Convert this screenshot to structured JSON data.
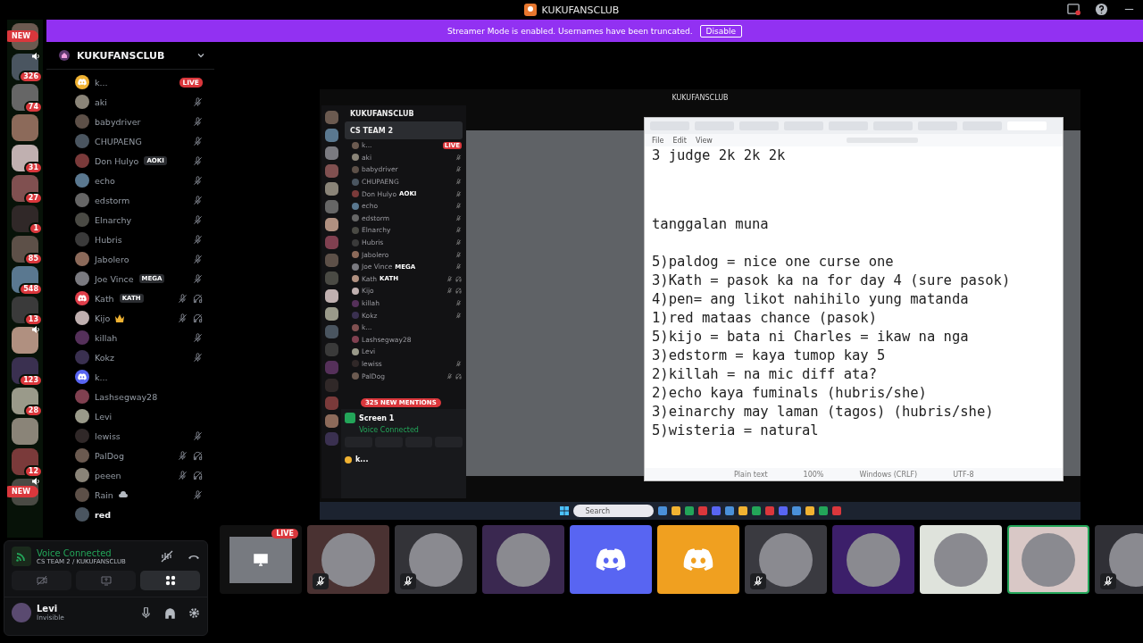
{
  "window": {
    "title": "KUKUFANSCLUB"
  },
  "servers": [
    {
      "badge": "NEW",
      "kind": "pill",
      "speaker": false
    },
    {
      "badge": "326",
      "speaker": true
    },
    {
      "badge": "74",
      "speaker": false
    },
    {
      "speaker": false
    },
    {
      "badge": "31",
      "speaker": false
    },
    {
      "badge": "27",
      "speaker": false
    },
    {
      "badge": "1",
      "speaker": false
    },
    {
      "badge": "85",
      "speaker": false
    },
    {
      "badge": "548",
      "speaker": false
    },
    {
      "badge": "13",
      "speaker": false
    },
    {
      "speaker": true
    },
    {
      "badge": "123",
      "speaker": false
    },
    {
      "badge": "28",
      "speaker": false
    },
    {
      "speaker": false
    },
    {
      "badge": "12",
      "speaker": false
    },
    {
      "badge": "NEW",
      "kind": "pill",
      "speaker": true
    }
  ],
  "banner": {
    "text": "Streamer Mode is enabled. Usernames have been truncated.",
    "button": "Disable"
  },
  "sidebar": {
    "title": "KUKUFANSCLUB"
  },
  "members": [
    {
      "name": "k...",
      "color": "#f0b232",
      "live": "LIVE",
      "muted": false,
      "deafened": false,
      "active": false
    },
    {
      "name": "aki",
      "muted": true,
      "deafened": false,
      "active": false
    },
    {
      "name": "babydriver",
      "muted": true,
      "deafened": false,
      "active": false
    },
    {
      "name": "CHUPAENG",
      "muted": true,
      "deafened": false,
      "active": false
    },
    {
      "name": "Don Hulyo",
      "tag": "AOKI",
      "muted": true,
      "deafened": false,
      "active": false
    },
    {
      "name": "echo",
      "muted": true,
      "deafened": false,
      "active": false
    },
    {
      "name": "edstorm",
      "muted": true,
      "deafened": false,
      "active": false
    },
    {
      "name": "Elnarchy",
      "muted": true,
      "deafened": false,
      "active": false
    },
    {
      "name": "Hubris",
      "muted": true,
      "deafened": false,
      "active": false
    },
    {
      "name": "Jabolero",
      "muted": true,
      "deafened": false,
      "active": false
    },
    {
      "name": "Joe Vince",
      "tag": "MEGA",
      "muted": true,
      "deafened": false,
      "active": false
    },
    {
      "name": "Kath",
      "color": "#e03e4a",
      "tag": "KATH",
      "muted": true,
      "deafened": true,
      "active": false
    },
    {
      "name": "Kijo",
      "kind": "crown",
      "muted": true,
      "deafened": true,
      "active": false
    },
    {
      "name": "killah",
      "muted": true,
      "deafened": false,
      "active": false
    },
    {
      "name": "Kokz",
      "muted": true,
      "deafened": false,
      "active": false
    },
    {
      "name": "k...",
      "color": "#5865f2",
      "muted": false,
      "deafened": false,
      "active": false
    },
    {
      "name": "Lashsegway28",
      "muted": false,
      "deafened": false,
      "active": false
    },
    {
      "name": "Levi",
      "muted": false,
      "deafened": false,
      "active": false
    },
    {
      "name": "lewiss",
      "muted": true,
      "deafened": false,
      "active": false
    },
    {
      "name": "PalDog",
      "muted": true,
      "deafened": true,
      "active": false
    },
    {
      "name": "peeen",
      "muted": true,
      "deafened": true,
      "active": false
    },
    {
      "name": "Rain",
      "kind": "cloud",
      "muted": true,
      "deafened": false,
      "active": false
    },
    {
      "name": "red",
      "muted": false,
      "deafened": false,
      "active": true
    }
  ],
  "voice": {
    "status": "Voice Connected",
    "channel": "CS TEAM 2 / KUKUFANSCLUB"
  },
  "user": {
    "name": "Levi",
    "status": "Invisible"
  },
  "stream": {
    "title": "KUKUFANSCLUB",
    "inner_discord": {
      "server": "KUKUFANSCLUB",
      "channel": "CS TEAM 2",
      "mentions": "325 NEW MENTIONS",
      "screen": "Screen 1",
      "voice": "Voice Connected",
      "user": "k..."
    },
    "inner_members": [
      {
        "name": "k...",
        "live": "LIVE",
        "muted": false,
        "deafened": false
      },
      {
        "name": "aki",
        "muted": true,
        "deafened": false
      },
      {
        "name": "babydriver",
        "muted": true,
        "deafened": false
      },
      {
        "name": "CHUPAENG",
        "muted": true,
        "deafened": false
      },
      {
        "name": "Don Hulyo",
        "tag": "AOKI",
        "muted": true,
        "deafened": false
      },
      {
        "name": "echo",
        "muted": true,
        "deafened": false
      },
      {
        "name": "edstorm",
        "muted": true,
        "deafened": false
      },
      {
        "name": "Elnarchy",
        "muted": true,
        "deafened": false
      },
      {
        "name": "Hubris",
        "muted": true,
        "deafened": false
      },
      {
        "name": "Jabolero",
        "muted": true,
        "deafened": false
      },
      {
        "name": "Joe Vince",
        "tag": "MEGA",
        "muted": true,
        "deafened": false
      },
      {
        "name": "Kath",
        "tag": "KATH",
        "muted": true,
        "deafened": true
      },
      {
        "name": "Kijo",
        "muted": true,
        "deafened": true
      },
      {
        "name": "killah",
        "muted": true,
        "deafened": false
      },
      {
        "name": "Kokz",
        "muted": true,
        "deafened": false
      },
      {
        "name": "k...",
        "muted": false,
        "deafened": false
      },
      {
        "name": "Lashsegway28",
        "muted": false,
        "deafened": false
      },
      {
        "name": "Levi",
        "muted": false,
        "deafened": false
      },
      {
        "name": "lewiss",
        "muted": true,
        "deafened": false
      },
      {
        "name": "PalDog",
        "muted": true,
        "deafened": true
      }
    ],
    "notepad": {
      "tabs": [
        {
          "selected": false
        },
        {
          "selected": false
        },
        {
          "selected": false
        },
        {
          "selected": false
        },
        {
          "selected": false
        },
        {
          "selected": false
        },
        {
          "selected": false
        },
        {
          "selected": false
        },
        {
          "selected": true
        }
      ],
      "menu": [
        "File",
        "Edit",
        "View"
      ],
      "blocks": [
        [
          "3 judge 2k 2k 2k"
        ],
        [
          "tanggalan muna"
        ],
        [
          "5)paldog = nice one curse one",
          "3)Kath = pasok ka na for day 4 (sure pasok)",
          "4)pen= ang likot nahihilo yung matanda",
          "1)red mataas chance (pasok)",
          "5)kijo = bata ni Charles = ikaw na nga",
          "3)edstorm = kaya tumop kay 5",
          "2)killah = na mic diff ata?",
          "2)echo kaya fuminals (hubris/she)",
          "3)einarchy may laman (tagos) (hubris/she)",
          "5)wisteria = natural"
        ]
      ],
      "status": [
        "Plain text",
        "100%",
        "Windows (CRLF)",
        "UTF-8"
      ]
    },
    "taskbar": {
      "search": "Search"
    }
  },
  "tiles": [
    {
      "kind": "screen",
      "live": "LIVE",
      "muted": false,
      "selected": false
    },
    {
      "kind": "photo",
      "color": "#4a3232",
      "muted": true,
      "selected": false
    },
    {
      "kind": "photo",
      "color": "#333338",
      "muted": true,
      "selected": false
    },
    {
      "kind": "photo",
      "color": "#3a2850",
      "muted": false,
      "selected": false
    },
    {
      "kind": "discord",
      "color": "#5865f2",
      "muted": false,
      "selected": false
    },
    {
      "kind": "discord",
      "color": "#f0a020",
      "muted": false,
      "selected": false
    },
    {
      "kind": "photo",
      "color": "#3a3a40",
      "muted": true,
      "selected": false
    },
    {
      "kind": "photo",
      "color": "#3c1f6a",
      "muted": false,
      "selected": false
    },
    {
      "kind": "photo",
      "color": "#dfe3dc",
      "muted": false,
      "selected": false
    },
    {
      "kind": "photo",
      "color": "#d9c8c6",
      "muted": false,
      "selected": true
    },
    {
      "kind": "photo",
      "color": "#303036",
      "muted": true,
      "selected": false
    }
  ]
}
